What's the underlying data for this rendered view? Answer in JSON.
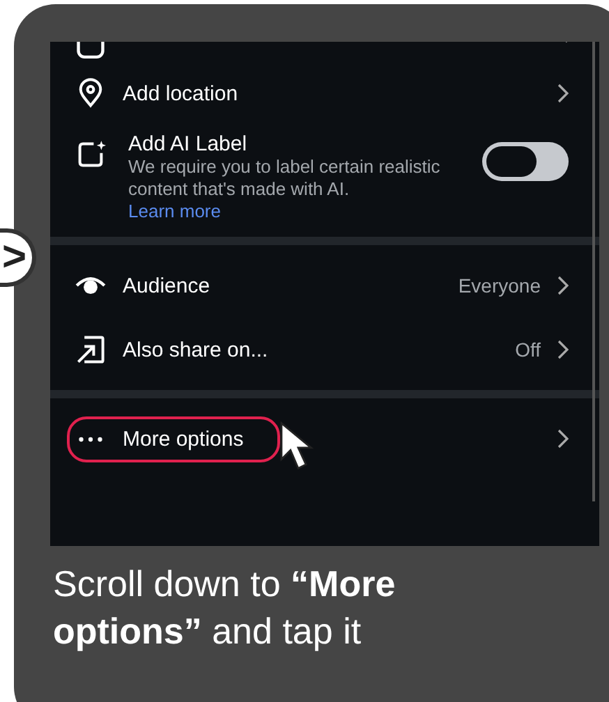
{
  "side_bubble": {
    "glyph": ">"
  },
  "sections": [
    {
      "rows": [
        {
          "kind": "cut"
        },
        {
          "kind": "link",
          "label": "Add location"
        },
        {
          "kind": "toggle",
          "label": "Add AI Label",
          "description": "We require you to label certain realistic content that's made with AI.",
          "link": "Learn more",
          "on": false
        }
      ]
    },
    {
      "rows": [
        {
          "kind": "link",
          "label": "Audience",
          "value": "Everyone"
        },
        {
          "kind": "link",
          "label": "Also share on...",
          "value": "Off"
        }
      ]
    },
    {
      "rows": [
        {
          "kind": "link",
          "label": "More options",
          "highlighted": true
        }
      ]
    }
  ],
  "caption": "Scroll down to **“More options”** and tap it"
}
